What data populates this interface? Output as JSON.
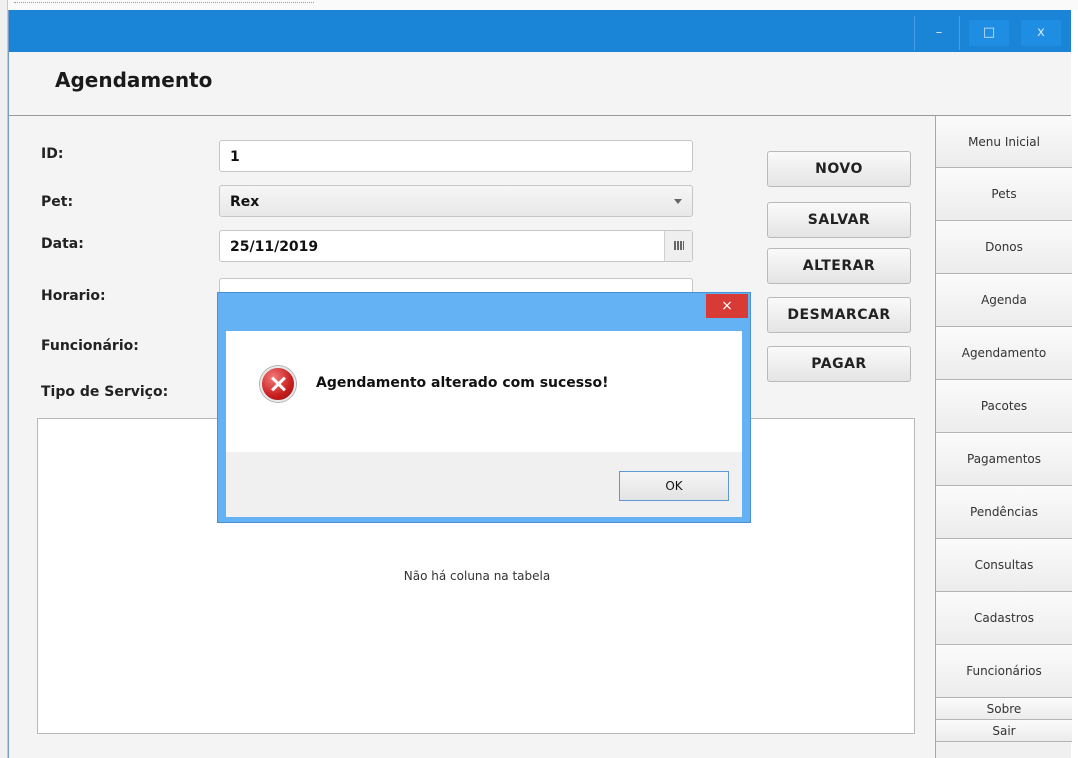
{
  "window": {
    "minimize_glyph": "–",
    "maximize_glyph": "□",
    "close_glyph": "x"
  },
  "page": {
    "title": "Agendamento"
  },
  "form": {
    "id_label": "ID:",
    "id_value": "1",
    "pet_label": "Pet:",
    "pet_value": "Rex",
    "data_label": "Data:",
    "data_value": "25/11/2019",
    "horario_label": "Horario:",
    "funcionario_label": "Funcionário:",
    "tipo_servico_label": "Tipo de Serviço:"
  },
  "actions": {
    "novo": "NOVO",
    "salvar": "SALVAR",
    "alterar": "ALTERAR",
    "desmarcar": "DESMARCAR",
    "pagar": "PAGAR"
  },
  "table": {
    "empty_message": "Não há coluna na tabela"
  },
  "sidebar": {
    "items": [
      {
        "label": "Menu Inicial"
      },
      {
        "label": "Pets"
      },
      {
        "label": "Donos"
      },
      {
        "label": "Agenda"
      },
      {
        "label": "Agendamento"
      },
      {
        "label": "Pacotes"
      },
      {
        "label": "Pagamentos"
      },
      {
        "label": "Pendências"
      },
      {
        "label": "Consultas"
      },
      {
        "label": "Cadastros"
      },
      {
        "label": "Funcionários"
      },
      {
        "label": "Sobre"
      },
      {
        "label": "Sair"
      }
    ]
  },
  "dialog": {
    "message": "Agendamento alterado com sucesso!",
    "ok_label": "OK",
    "close_glyph": "×",
    "icon": "error-icon"
  },
  "colors": {
    "titlebar": "#1a84d6",
    "dialog_frame": "#64b1f4",
    "dialog_close": "#d83b35"
  }
}
